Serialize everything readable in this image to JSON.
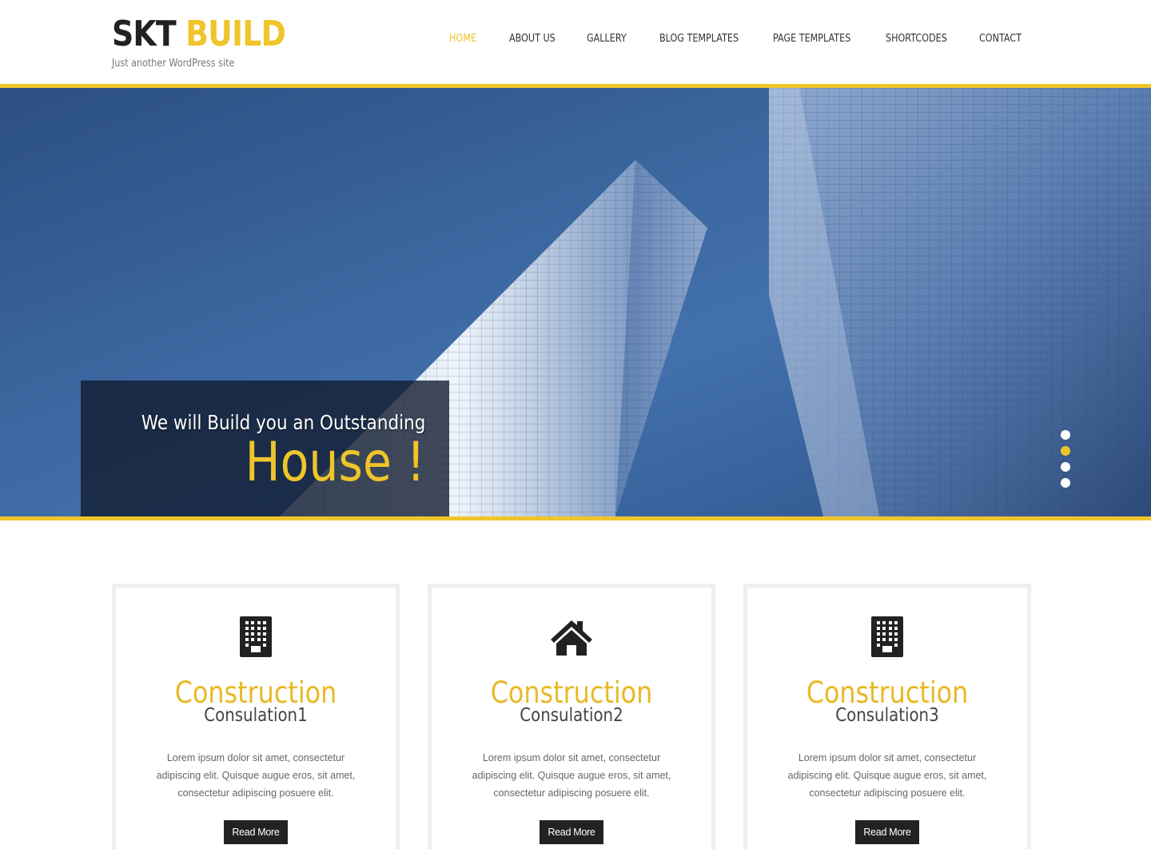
{
  "site": {
    "title_part1": "SKT",
    "title_part2": "BUILD",
    "tagline": "Just another WordPress site",
    "accent_color": "#efc52a"
  },
  "nav": {
    "items": [
      {
        "label": "HOME",
        "active": true
      },
      {
        "label": "ABOUT US",
        "active": false
      },
      {
        "label": "GALLERY",
        "active": false
      },
      {
        "label": "BLOG TEMPLATES",
        "active": false
      },
      {
        "label": "PAGE TEMPLATES",
        "active": false
      },
      {
        "label": "SHORTCODES",
        "active": false
      },
      {
        "label": "CONTACT",
        "active": false
      }
    ]
  },
  "hero": {
    "line1": "We will Build you an Outstanding",
    "line2": "House !",
    "slide_count": 4,
    "active_slide": 2
  },
  "features": [
    {
      "icon": "building-icon",
      "title": "Construction",
      "subtitle": "Consulation1",
      "text": "Lorem ipsum dolor sit amet, consectetur adipiscing elit. Quisque augue eros, sit amet, consectetur adipiscing posuere elit.",
      "button": "Read More"
    },
    {
      "icon": "home-icon",
      "title": "Construction",
      "subtitle": "Consulation2",
      "text": "Lorem ipsum dolor sit amet, consectetur adipiscing elit. Quisque augue eros, sit amet, consectetur adipiscing posuere elit.",
      "button": "Read More"
    },
    {
      "icon": "building-icon",
      "title": "Construction",
      "subtitle": "Consulation3",
      "text": "Lorem ipsum dolor sit amet, consectetur adipiscing elit. Quisque augue eros, sit amet, consectetur adipiscing posuere elit.",
      "button": "Read More"
    }
  ]
}
